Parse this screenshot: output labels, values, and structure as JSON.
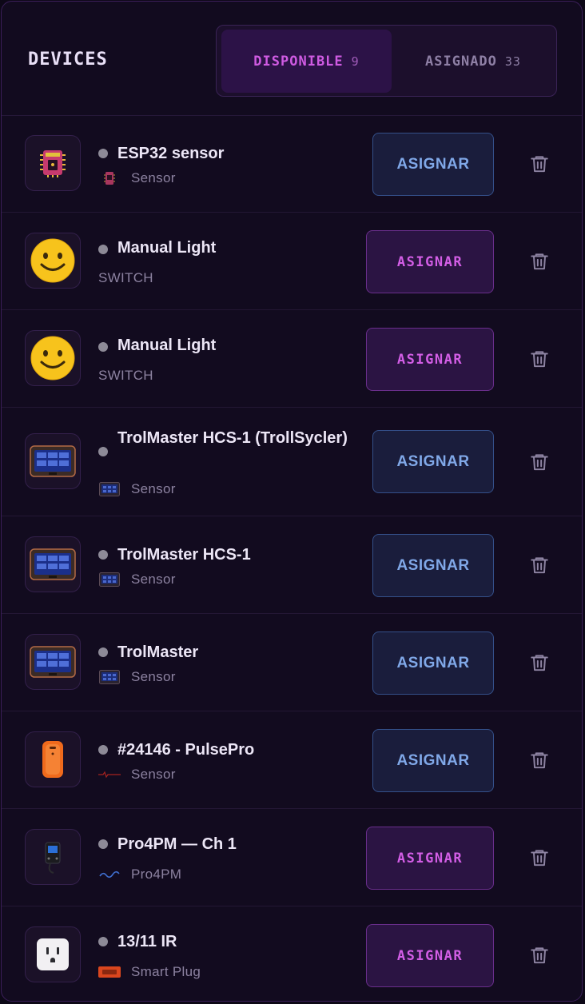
{
  "header": {
    "title": "DEVICES",
    "tabs": [
      {
        "label": "DISPONIBLE",
        "count": "9",
        "active": true
      },
      {
        "label": "ASIGNADO",
        "count": "33",
        "active": false
      }
    ]
  },
  "colors": {
    "accent_purple": "#cf5be2",
    "button_blue_text": "#80a8e8",
    "status_dot": "#8d8a97"
  },
  "devices": [
    {
      "name": "ESP32 sensor",
      "type": "Sensor",
      "icon": "esp32-chip-icon",
      "sub_logo": "esp32-chip-small-icon",
      "button": "ASIGNAR",
      "button_style": "blue"
    },
    {
      "name": "Manual Light",
      "type": "SWITCH",
      "icon": "smiley-face-icon",
      "sub_logo": "",
      "button": "ASIGNAR",
      "button_style": "purple"
    },
    {
      "name": "Manual Light",
      "type": "SWITCH",
      "icon": "smiley-face-icon",
      "sub_logo": "",
      "button": "ASIGNAR",
      "button_style": "purple"
    },
    {
      "name": "TrolMaster HCS-1 (TrollSycler)",
      "type": "Sensor",
      "icon": "trolmaster-controller-icon",
      "sub_logo": "trolmaster-small-icon",
      "button": "ASIGNAR",
      "button_style": "blue"
    },
    {
      "name": "TrolMaster HCS-1",
      "type": "Sensor",
      "icon": "trolmaster-controller-icon",
      "sub_logo": "trolmaster-small-icon",
      "button": "ASIGNAR",
      "button_style": "blue"
    },
    {
      "name": "TrolMaster",
      "type": "Sensor",
      "icon": "trolmaster-controller-icon",
      "sub_logo": "trolmaster-small-icon",
      "button": "ASIGNAR",
      "button_style": "blue"
    },
    {
      "name": "#24146 - PulsePro",
      "type": "Sensor",
      "icon": "pulsepro-device-icon",
      "sub_logo": "pulse-logo-icon",
      "button": "ASIGNAR",
      "button_style": "blue"
    },
    {
      "name": "Pro4PM — Ch 1",
      "type": "Pro4PM",
      "icon": "pro4pm-module-icon",
      "sub_logo": "shelly-logo-icon",
      "button": "ASIGNAR",
      "button_style": "purple"
    },
    {
      "name": "13/11 IR",
      "type": "Smart Plug",
      "icon": "smart-plug-icon",
      "sub_logo": "tuya-logo-icon",
      "button": "ASIGNAR",
      "button_style": "purple"
    }
  ]
}
